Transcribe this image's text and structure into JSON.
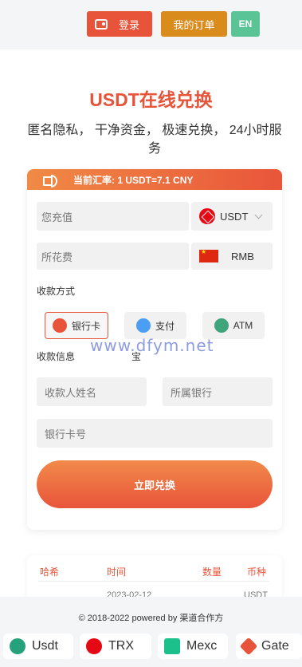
{
  "header": {
    "login_label": "登录",
    "orders_label": "我的订单",
    "lang_label": "EN"
  },
  "hero": {
    "title": "USDT在线兑换",
    "subtitle": "匿名隐私， 干净资金， 极速兑换， 24小时服务"
  },
  "exchange": {
    "rate_text": "当前汇率: 1 USDT=7.1 CNY",
    "amount_placeholder": "您充值",
    "coin_selected": "USDT",
    "cost_placeholder": "所花费",
    "cost_currency": "RMB",
    "payment_label": "收款方式",
    "payment_methods": [
      {
        "label": "银行卡",
        "icon": "bank-card-icon",
        "active": true
      },
      {
        "label": "支付",
        "icon": "alipay-icon",
        "active": false
      },
      {
        "label": "ATM",
        "icon": "atm-icon",
        "active": false
      }
    ],
    "payment_extra": "宝",
    "receiver_label": "收款信息",
    "name_placeholder": "收款人姓名",
    "bank_placeholder": "所属银行",
    "card_placeholder": "银行卡号",
    "submit_label": "立即兑换"
  },
  "orders": {
    "headers": [
      "哈希",
      "时间",
      "数量",
      "币种"
    ],
    "first_row_time": "2023-02-12",
    "first_row_coin": "USDT"
  },
  "footer": {
    "copyright": "© 2018-2022 powered by 渠道合作方",
    "partners": [
      {
        "label": "Usdt",
        "icon": "tether-icon"
      },
      {
        "label": "TRX",
        "icon": "tron-icon"
      },
      {
        "label": "Mexc",
        "icon": "mexc-icon"
      },
      {
        "label": "Gate",
        "icon": "gate-icon"
      }
    ]
  },
  "watermark": "www.dfym.net",
  "colors": {
    "accent": "#e8543a",
    "orders_button": "#d98b1c",
    "lang_button": "#5bc497"
  }
}
